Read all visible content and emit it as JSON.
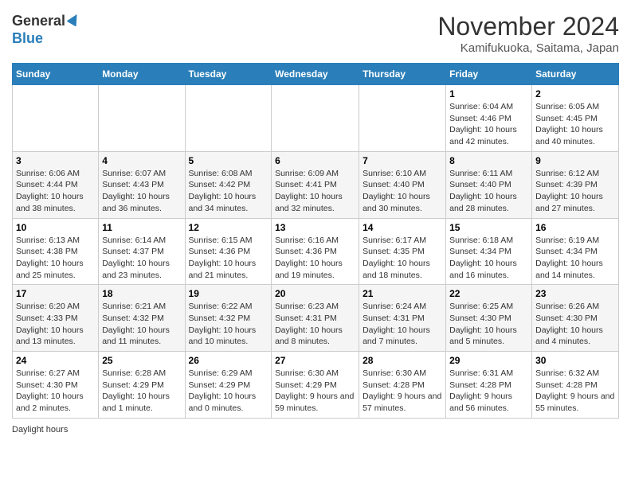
{
  "header": {
    "logo_general": "General",
    "logo_blue": "Blue",
    "title": "November 2024",
    "subtitle": "Kamifukuoka, Saitama, Japan"
  },
  "calendar": {
    "days_of_week": [
      "Sunday",
      "Monday",
      "Tuesday",
      "Wednesday",
      "Thursday",
      "Friday",
      "Saturday"
    ],
    "weeks": [
      [
        {
          "day": "",
          "info": ""
        },
        {
          "day": "",
          "info": ""
        },
        {
          "day": "",
          "info": ""
        },
        {
          "day": "",
          "info": ""
        },
        {
          "day": "",
          "info": ""
        },
        {
          "day": "1",
          "info": "Sunrise: 6:04 AM\nSunset: 4:46 PM\nDaylight: 10 hours and 42 minutes."
        },
        {
          "day": "2",
          "info": "Sunrise: 6:05 AM\nSunset: 4:45 PM\nDaylight: 10 hours and 40 minutes."
        }
      ],
      [
        {
          "day": "3",
          "info": "Sunrise: 6:06 AM\nSunset: 4:44 PM\nDaylight: 10 hours and 38 minutes."
        },
        {
          "day": "4",
          "info": "Sunrise: 6:07 AM\nSunset: 4:43 PM\nDaylight: 10 hours and 36 minutes."
        },
        {
          "day": "5",
          "info": "Sunrise: 6:08 AM\nSunset: 4:42 PM\nDaylight: 10 hours and 34 minutes."
        },
        {
          "day": "6",
          "info": "Sunrise: 6:09 AM\nSunset: 4:41 PM\nDaylight: 10 hours and 32 minutes."
        },
        {
          "day": "7",
          "info": "Sunrise: 6:10 AM\nSunset: 4:40 PM\nDaylight: 10 hours and 30 minutes."
        },
        {
          "day": "8",
          "info": "Sunrise: 6:11 AM\nSunset: 4:40 PM\nDaylight: 10 hours and 28 minutes."
        },
        {
          "day": "9",
          "info": "Sunrise: 6:12 AM\nSunset: 4:39 PM\nDaylight: 10 hours and 27 minutes."
        }
      ],
      [
        {
          "day": "10",
          "info": "Sunrise: 6:13 AM\nSunset: 4:38 PM\nDaylight: 10 hours and 25 minutes."
        },
        {
          "day": "11",
          "info": "Sunrise: 6:14 AM\nSunset: 4:37 PM\nDaylight: 10 hours and 23 minutes."
        },
        {
          "day": "12",
          "info": "Sunrise: 6:15 AM\nSunset: 4:36 PM\nDaylight: 10 hours and 21 minutes."
        },
        {
          "day": "13",
          "info": "Sunrise: 6:16 AM\nSunset: 4:36 PM\nDaylight: 10 hours and 19 minutes."
        },
        {
          "day": "14",
          "info": "Sunrise: 6:17 AM\nSunset: 4:35 PM\nDaylight: 10 hours and 18 minutes."
        },
        {
          "day": "15",
          "info": "Sunrise: 6:18 AM\nSunset: 4:34 PM\nDaylight: 10 hours and 16 minutes."
        },
        {
          "day": "16",
          "info": "Sunrise: 6:19 AM\nSunset: 4:34 PM\nDaylight: 10 hours and 14 minutes."
        }
      ],
      [
        {
          "day": "17",
          "info": "Sunrise: 6:20 AM\nSunset: 4:33 PM\nDaylight: 10 hours and 13 minutes."
        },
        {
          "day": "18",
          "info": "Sunrise: 6:21 AM\nSunset: 4:32 PM\nDaylight: 10 hours and 11 minutes."
        },
        {
          "day": "19",
          "info": "Sunrise: 6:22 AM\nSunset: 4:32 PM\nDaylight: 10 hours and 10 minutes."
        },
        {
          "day": "20",
          "info": "Sunrise: 6:23 AM\nSunset: 4:31 PM\nDaylight: 10 hours and 8 minutes."
        },
        {
          "day": "21",
          "info": "Sunrise: 6:24 AM\nSunset: 4:31 PM\nDaylight: 10 hours and 7 minutes."
        },
        {
          "day": "22",
          "info": "Sunrise: 6:25 AM\nSunset: 4:30 PM\nDaylight: 10 hours and 5 minutes."
        },
        {
          "day": "23",
          "info": "Sunrise: 6:26 AM\nSunset: 4:30 PM\nDaylight: 10 hours and 4 minutes."
        }
      ],
      [
        {
          "day": "24",
          "info": "Sunrise: 6:27 AM\nSunset: 4:30 PM\nDaylight: 10 hours and 2 minutes."
        },
        {
          "day": "25",
          "info": "Sunrise: 6:28 AM\nSunset: 4:29 PM\nDaylight: 10 hours and 1 minute."
        },
        {
          "day": "26",
          "info": "Sunrise: 6:29 AM\nSunset: 4:29 PM\nDaylight: 10 hours and 0 minutes."
        },
        {
          "day": "27",
          "info": "Sunrise: 6:30 AM\nSunset: 4:29 PM\nDaylight: 9 hours and 59 minutes."
        },
        {
          "day": "28",
          "info": "Sunrise: 6:30 AM\nSunset: 4:28 PM\nDaylight: 9 hours and 57 minutes."
        },
        {
          "day": "29",
          "info": "Sunrise: 6:31 AM\nSunset: 4:28 PM\nDaylight: 9 hours and 56 minutes."
        },
        {
          "day": "30",
          "info": "Sunrise: 6:32 AM\nSunset: 4:28 PM\nDaylight: 9 hours and 55 minutes."
        }
      ]
    ]
  },
  "footer": {
    "daylight_label": "Daylight hours"
  }
}
